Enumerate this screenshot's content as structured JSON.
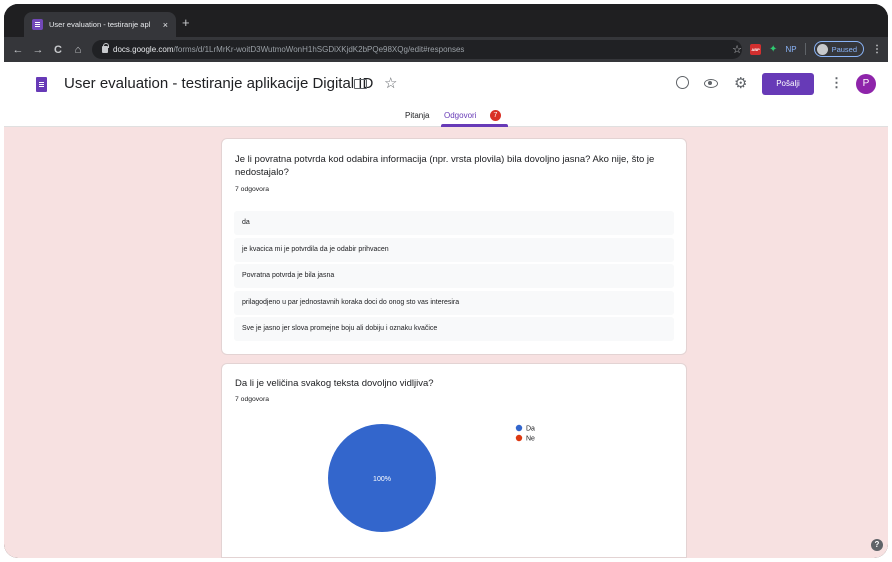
{
  "browser": {
    "tab_title": "User evaluation - testiranje apl",
    "tab_close": "×",
    "new_tab": "+",
    "back": "←",
    "forward": "→",
    "reload": "C",
    "home": "⌂",
    "url_host": "docs.google.com",
    "url_path": "/forms/d/1LrMrKr-woitD3WutmoWonH1hSGDiXKjdK2bPQe98XQg/edit#responses",
    "star": "☆",
    "ext_abp": "ABP",
    "ext_green": "✦",
    "ext_np": "NP",
    "profile_status": "Paused",
    "menu": "⋮"
  },
  "form": {
    "title": "User evaluation - testiranje aplikacije Digital ID",
    "send_label": "Pošalji",
    "avatar_letter": "P",
    "more": "⋮",
    "star": "☆",
    "gear": "⚙",
    "tabs": {
      "questions": "Pitanja",
      "responses": "Odgovori",
      "responses_count": "7"
    }
  },
  "question1": {
    "title": "Je li povratna potvrda kod odabira informacija (npr. vrsta plovila) bila dovoljno jasna? Ako nije, što je nedostajalo?",
    "count": "7 odgovora",
    "answers": [
      "da",
      "je kvacica mi je potvrdila da je odabir prihvacen",
      "Povratna potvrda je bila jasna",
      "prilagodjeno u par jednostavnih koraka doci do onog sto vas interesira",
      "Sve je jasno jer slova promejne boju ali dobiju i oznaku kvačice"
    ]
  },
  "question2": {
    "title": "Da li je veličina svakog teksta dovoljno vidljiva?",
    "count": "7 odgovora"
  },
  "chart_data": {
    "type": "pie",
    "categories": [
      "Da",
      "Ne"
    ],
    "values": [
      100,
      0
    ],
    "labels": [
      "100%",
      ""
    ],
    "colors": [
      "#3366cc",
      "#dc3912"
    ],
    "legend_position": "right"
  },
  "help": "?"
}
